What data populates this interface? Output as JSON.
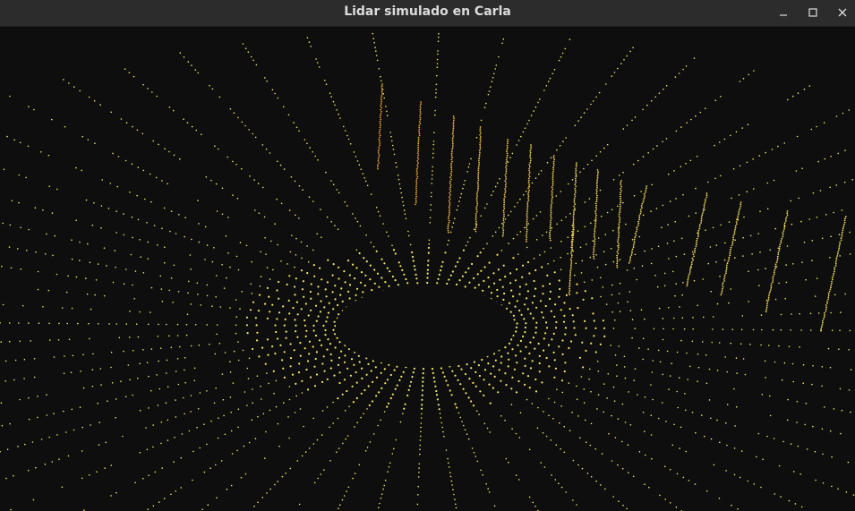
{
  "window": {
    "title": "Lidar simulado en Carla"
  },
  "controls": {
    "minimize_icon": "minimize-icon",
    "maximize_icon": "maximize-icon",
    "close_icon": "close-icon"
  },
  "viewport": {
    "background": "#0e0e0e",
    "near_color": "#f2ea6a",
    "far_color": "#e3962b",
    "point_cloud": "lidar-point-cloud"
  }
}
